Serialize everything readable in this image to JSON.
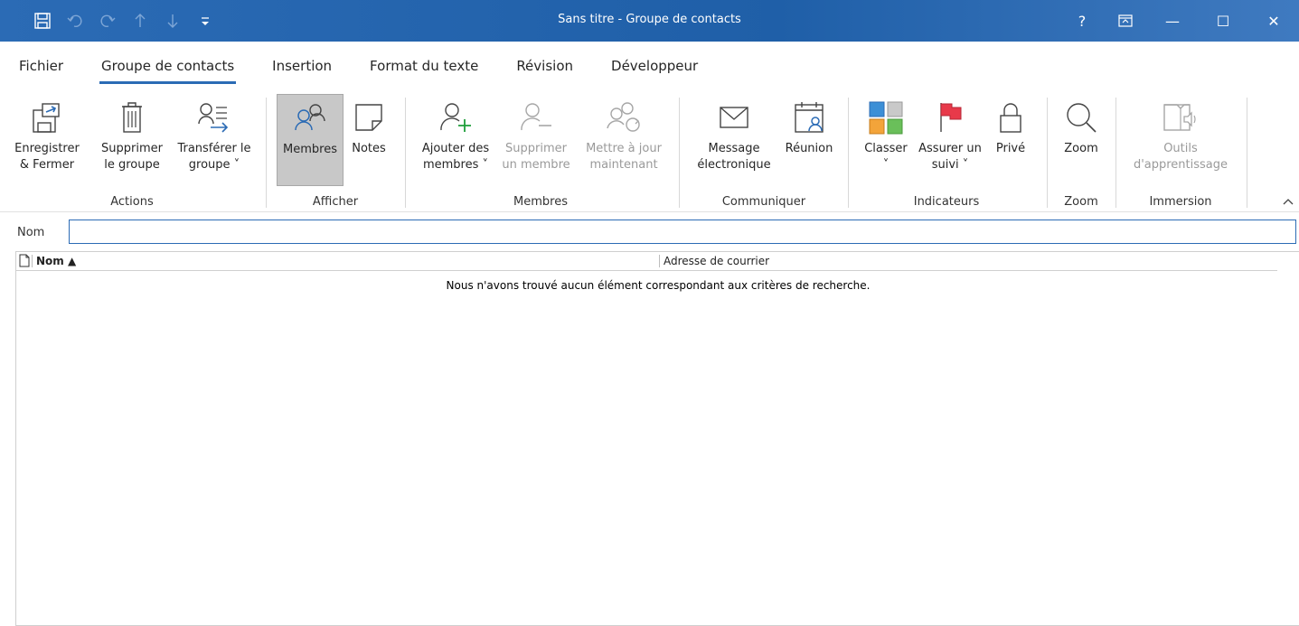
{
  "window": {
    "title": "Sans titre  -  Groupe de contacts",
    "controls": {
      "help": "?",
      "minimize": "—",
      "maximize": "☐",
      "close": "✕"
    }
  },
  "quick_access": [
    "save-icon",
    "undo-icon",
    "redo-icon",
    "up-icon",
    "down-icon",
    "customize-icon"
  ],
  "tabs": [
    {
      "label": "Fichier",
      "active": false
    },
    {
      "label": "Groupe de contacts",
      "active": true
    },
    {
      "label": "Insertion",
      "active": false
    },
    {
      "label": "Format du texte",
      "active": false
    },
    {
      "label": "Révision",
      "active": false
    },
    {
      "label": "Développeur",
      "active": false
    }
  ],
  "ribbon": {
    "actions": {
      "label": "Actions",
      "save_close": {
        "line1": "Enregistrer",
        "line2": "& Fermer"
      },
      "delete_group": {
        "line1": "Supprimer",
        "line2": "le groupe"
      },
      "forward_group": {
        "line1": "Transférer le",
        "line2": "groupe ˅"
      }
    },
    "show": {
      "label": "Afficher",
      "members": "Membres",
      "notes": "Notes"
    },
    "members": {
      "label": "Membres",
      "add": {
        "line1": "Ajouter des",
        "line2": "membres ˅"
      },
      "remove": {
        "line1": "Supprimer",
        "line2": "un membre"
      },
      "update": {
        "line1": "Mettre à jour",
        "line2": "maintenant"
      }
    },
    "communicate": {
      "label": "Communiquer",
      "email": {
        "line1": "Message",
        "line2": "électronique"
      },
      "meeting": "Réunion"
    },
    "tags": {
      "label": "Indicateurs",
      "categorize": {
        "line1": "Classer",
        "line2": "˅"
      },
      "followup": {
        "line1": "Assurer un",
        "line2": "suivi ˅"
      },
      "private": "Privé"
    },
    "zoom": {
      "label": "Zoom",
      "button": "Zoom"
    },
    "immersive": {
      "label": "Immersion",
      "reader": {
        "line1": "Outils",
        "line2": "d'apprentissage"
      }
    }
  },
  "form": {
    "name_label": "Nom",
    "name_value": ""
  },
  "list": {
    "col_name": "Nom ▲",
    "col_email": "Adresse de courrier",
    "empty_message": "Nous n'avons trouvé aucun élément correspondant aux critères de recherche."
  },
  "colors": {
    "accent": "#2b6bb5",
    "titlebar": "#1f5fa8"
  }
}
